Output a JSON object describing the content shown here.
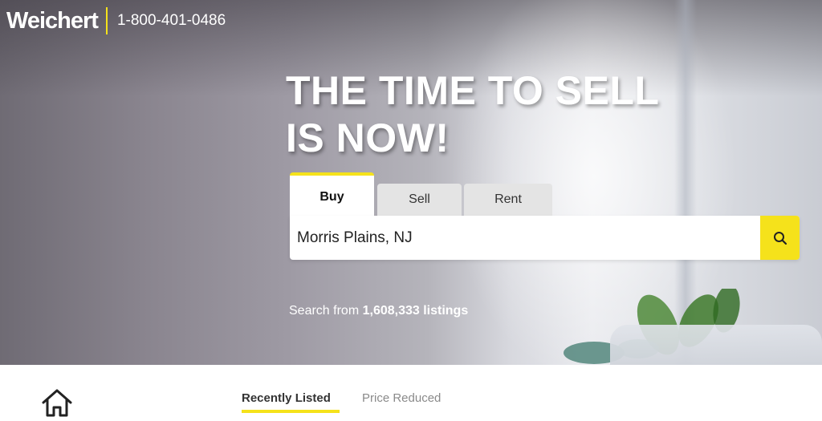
{
  "header": {
    "logo_text": "Weichert",
    "phone": "1-800-401-0486"
  },
  "hero": {
    "headline_line1": "THE TIME TO SELL",
    "headline_line2": "IS NOW!"
  },
  "search": {
    "tabs": [
      {
        "label": "Buy",
        "active": true
      },
      {
        "label": "Sell",
        "active": false
      },
      {
        "label": "Rent",
        "active": false
      }
    ],
    "input_value": "Morris Plains, NJ",
    "search_icon": "search-icon",
    "listings_prefix": "Search from",
    "listings_count": "1,608,333 listings"
  },
  "feed": {
    "home_icon": "home-icon",
    "tabs": [
      {
        "label": "Recently Listed",
        "active": true
      },
      {
        "label": "Price Reduced",
        "active": false
      }
    ]
  },
  "colors": {
    "accent": "#f5e21b",
    "text_dark": "#333333",
    "tab_inactive_bg": "#e4e4e4"
  }
}
